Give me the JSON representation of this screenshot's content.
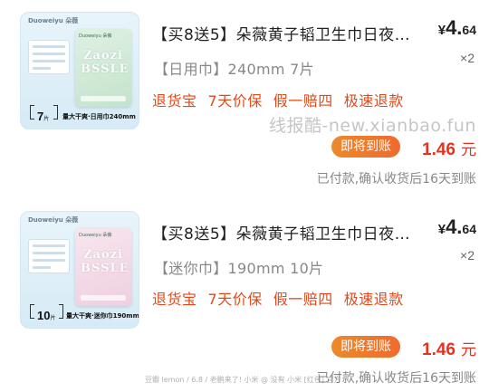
{
  "items": [
    {
      "title": "【买8送5】朵薇黄子韬卫生巾日夜…",
      "price_currency": "¥",
      "price_int": "4.",
      "price_dec": "64",
      "quantity": "×2",
      "variant": "【日用巾】240mm 7片",
      "tags": [
        "退货宝",
        "7天价保",
        "假一赔四",
        "极速退款"
      ],
      "button": "即将到账",
      "amount": "1.46",
      "amount_unit": "元",
      "note": "已付款,确认收货后16天到账",
      "thumb": {
        "brand": "Duoweiyu 朵薇",
        "pack_art": "Zaozi\nBSSLE",
        "count": "7",
        "count_unit": "片",
        "caption": "量大干爽·日用巾240mm"
      }
    },
    {
      "title": "【买8送5】朵薇黄子韬卫生巾日夜…",
      "price_currency": "¥",
      "price_int": "4.",
      "price_dec": "64",
      "quantity": "×2",
      "variant": "【迷你巾】190mm 10片",
      "tags": [
        "退货宝",
        "7天价保",
        "假一赔四",
        "极速退款"
      ],
      "button": "即将到账",
      "amount": "1.46",
      "amount_unit": "元",
      "note": "已付款,确认收货后16天到账",
      "thumb": {
        "brand": "Duoweiyu 朵薇",
        "pack_art": "Zaozi\nBSSLE",
        "count": "10",
        "count_unit": "片",
        "caption": "量大干爽·迷你巾190mm"
      }
    }
  ],
  "watermark": "线报酷-new.xianbao.fun",
  "footer_watermark": "豆瓣 lemon / 6.8 / 老鹏来了! 小米 @ 没有 小米 [红包] 官方"
}
